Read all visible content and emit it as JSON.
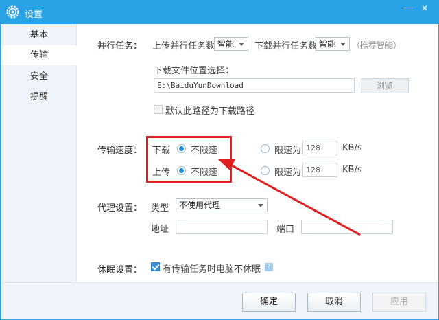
{
  "window": {
    "title": "设置",
    "minimize": "—",
    "close": "✕"
  },
  "sidebar": {
    "items": [
      {
        "label": "基本"
      },
      {
        "label": "传输"
      },
      {
        "label": "安全"
      },
      {
        "label": "提醒"
      }
    ],
    "active_index": 1
  },
  "parallel": {
    "section_label": "并行任务：",
    "upload_label": "上传并行任务数",
    "upload_value": "智能",
    "download_label": "下载并行任务数",
    "download_value": "智能",
    "recommend_note": "（推荐智能）"
  },
  "download_location": {
    "label": "下载文件位置选择：",
    "path": "E:\\BaiduYunDownload",
    "browse_label": "浏览",
    "default_checkbox_label": "默认此路径为下载路径",
    "default_checked": false
  },
  "speed": {
    "section_label": "传输速度：",
    "download_label": "下载",
    "upload_label": "上传",
    "unlimited_label": "不限速",
    "limit_label": "限速为",
    "download_limit_value": "128",
    "upload_limit_value": "128",
    "unit": "KB/s",
    "download_unlimited_selected": true,
    "upload_unlimited_selected": true
  },
  "proxy": {
    "section_label": "代理设置：",
    "type_label": "类型",
    "type_value": "不使用代理",
    "address_label": "地址",
    "port_label": "端口",
    "address_value": "",
    "port_value": ""
  },
  "sleep": {
    "section_label": "休眠设置：",
    "checkbox_label": "有传输任务时电脑不休眠",
    "checked": true,
    "help": "?"
  },
  "footer": {
    "ok_label": "确定",
    "cancel_label": "取消",
    "apply_label": "应用"
  },
  "colors": {
    "titlebar": "#2aa3e6",
    "annotation": "#e02020",
    "sidebar_bg": "#eef4fa"
  }
}
